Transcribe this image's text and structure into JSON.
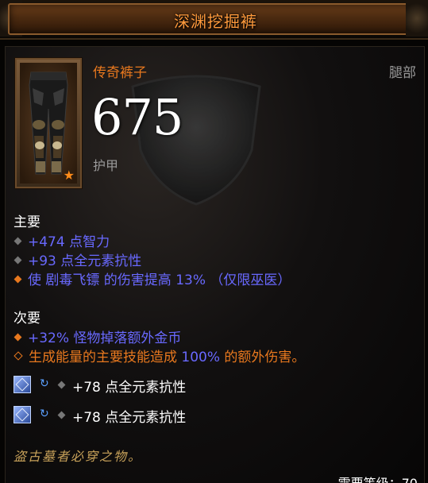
{
  "title": "深渊挖掘裤",
  "item": {
    "type": "传奇裤子",
    "slot": "腿部",
    "armor_value": "675",
    "armor_label": "护甲"
  },
  "primary": {
    "header": "主要",
    "affixes": [
      {
        "parts": [
          "+474 点智力"
        ]
      },
      {
        "parts": [
          "+93 点全元素抗性"
        ]
      },
      {
        "parts": [
          "使 ",
          "剧毒飞镖",
          " 的伤害提高 ",
          "13%",
          " （仅限巫医）"
        ]
      }
    ]
  },
  "secondary": {
    "header": "次要",
    "affixes": [
      {
        "parts": [
          "+32% 怪物掉落额外金币"
        ]
      },
      {
        "parts": [
          "生成能量的主要技能造成 ",
          "100%",
          " 的额外伤害。"
        ]
      }
    ]
  },
  "sockets": [
    {
      "text": "+78 点全元素抗性",
      "gem_icon": "gem-icon"
    },
    {
      "text": "+78 点全元素抗性",
      "gem_icon": "gem-icon"
    }
  ],
  "flavor_text": "盗古墓者必穿之物。",
  "required_level": "需要等级：70",
  "colors": {
    "legendary_orange": "#e8781e",
    "magic_blue": "#6969ff",
    "flavor_gold": "#c8a25a",
    "grey": "#9a9a9a"
  }
}
